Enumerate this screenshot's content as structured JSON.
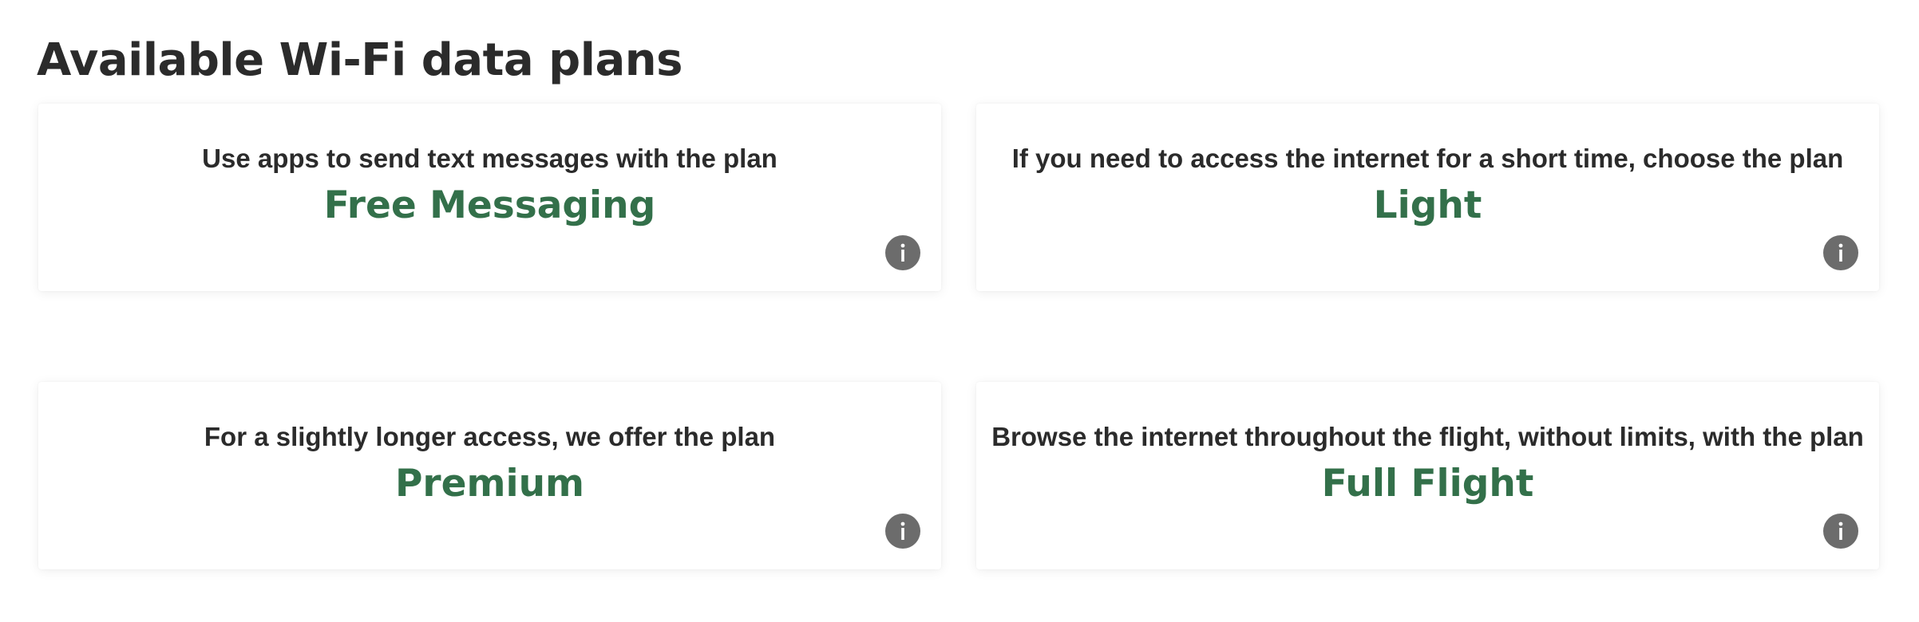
{
  "page": {
    "title": "Available Wi-Fi data plans"
  },
  "plans": [
    {
      "description": "Use apps to send text messages with the plan",
      "name": "Free Messaging",
      "info_icon": "info-icon"
    },
    {
      "description": "If you need to access the internet for a short time, choose the plan",
      "name": "Light",
      "info_icon": "info-icon"
    },
    {
      "description": "For a slightly longer access, we offer the plan",
      "name": "Premium",
      "info_icon": "info-icon"
    },
    {
      "description": "Browse the internet throughout the flight, without limits, with the plan",
      "name": "Full Flight",
      "info_icon": "info-icon"
    }
  ],
  "colors": {
    "accent": "#33704a",
    "text": "#2b2b2b",
    "info_icon_bg": "#6c6c6c",
    "background": "#ffffff"
  }
}
